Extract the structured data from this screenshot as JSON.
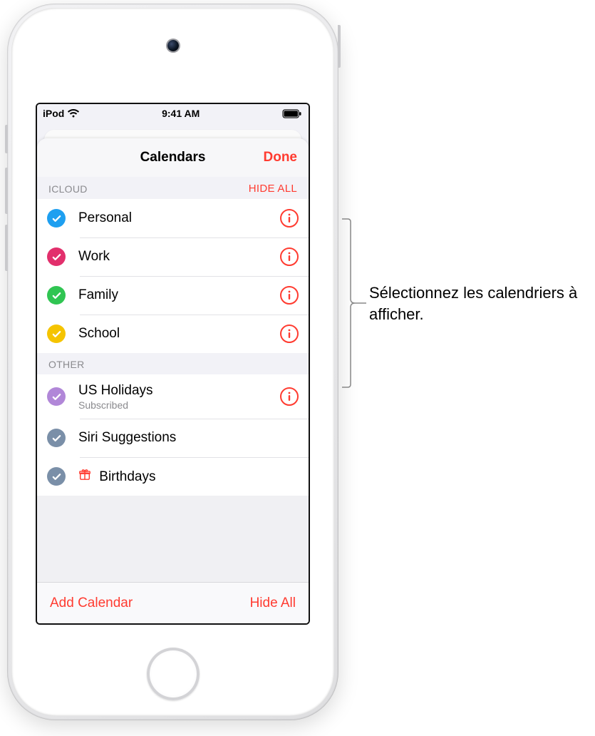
{
  "status_bar": {
    "carrier": "iPod",
    "time": "9:41 AM"
  },
  "sheet": {
    "title": "Calendars",
    "done_label": "Done"
  },
  "sections": {
    "icloud": {
      "title": "ICLOUD",
      "action": "HIDE ALL",
      "items": [
        {
          "label": "Personal",
          "color": "#1e9ff0"
        },
        {
          "label": "Work",
          "color": "#e22f6c"
        },
        {
          "label": "Family",
          "color": "#30c552"
        },
        {
          "label": "School",
          "color": "#f5c400"
        }
      ]
    },
    "other": {
      "title": "OTHER",
      "items": [
        {
          "label": "US Holidays",
          "sub": "Subscribed",
          "color": "#b187d8",
          "has_info": true
        },
        {
          "label": "Siri Suggestions",
          "color": "#7a8fa8",
          "has_info": false
        },
        {
          "label": "Birthdays",
          "color": "#7a8fa8",
          "has_info": false,
          "icon": "gift"
        }
      ]
    }
  },
  "footer": {
    "add": "Add Calendar",
    "hide": "Hide All"
  },
  "callout": {
    "text": "Sélectionnez les calendriers à afficher."
  }
}
